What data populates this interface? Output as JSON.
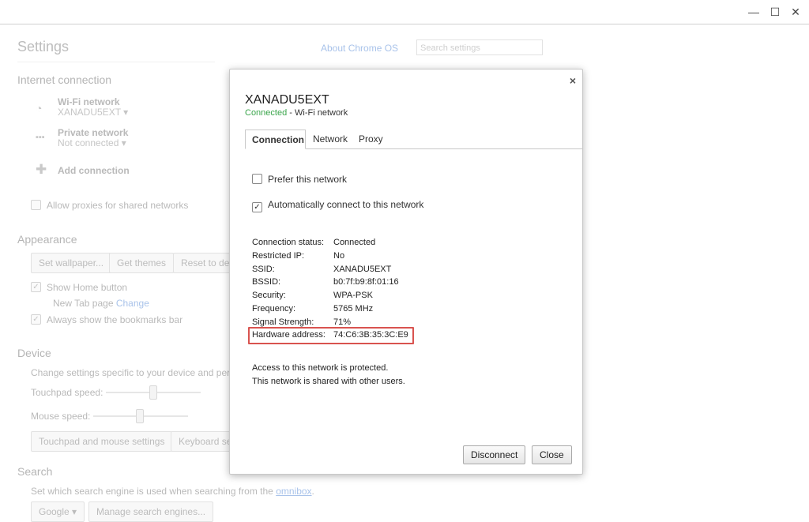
{
  "window": {
    "minimize": "—",
    "maximize": "☐",
    "close": "✕"
  },
  "settings": {
    "title": "Settings",
    "about_link": "About Chrome OS",
    "search_placeholder": "Search settings",
    "internet": {
      "heading": "Internet connection",
      "wifi_label": "Wi-Fi network",
      "wifi_value": "XANADU5EXT",
      "private_label": "Private network",
      "private_value": "Not connected",
      "add_connection": "Add connection",
      "allow_proxies": "Allow proxies for shared networks"
    },
    "appearance": {
      "heading": "Appearance",
      "set_wallpaper": "Set wallpaper...",
      "get_themes": "Get themes",
      "reset": "Reset to defa",
      "show_home": "Show Home button",
      "new_tab": "New Tab page",
      "change": "Change",
      "bookmarks_bar": "Always show the bookmarks bar"
    },
    "device": {
      "heading": "Device",
      "desc": "Change settings specific to your device and periph",
      "touchpad_speed": "Touchpad speed:",
      "mouse_speed": "Mouse speed:",
      "touchpad_mouse_btn": "Touchpad and mouse settings",
      "keyboard_btn": "Keyboard se"
    },
    "search": {
      "heading": "Search",
      "desc": "Set which search engine is used when searching from the",
      "omnibox": "omnibox",
      "engine": "Google",
      "manage": "Manage search engines..."
    }
  },
  "dialog": {
    "title": "XANADU5EXT",
    "status": "Connected",
    "status_suffix": " - Wi-Fi network",
    "tabs": [
      "Connection",
      "Network",
      "Proxy"
    ],
    "prefer_label": "Prefer this network",
    "prefer_checked": false,
    "auto_label": "Automatically connect to this network",
    "auto_checked": true,
    "details": [
      {
        "label": "Connection status:",
        "value": "Connected"
      },
      {
        "label": "Restricted IP:",
        "value": "No"
      },
      {
        "label": "SSID:",
        "value": "XANADU5EXT"
      },
      {
        "label": "BSSID:",
        "value": "b0:7f:b9:8f:01:16"
      },
      {
        "label": "Security:",
        "value": "WPA-PSK"
      },
      {
        "label": "Frequency:",
        "value": "5765 MHz"
      },
      {
        "label": "Signal Strength:",
        "value": "71%"
      },
      {
        "label": "Hardware address:",
        "value": "74:C6:3B:35:3C:E9"
      }
    ],
    "note1": "Access to this network is protected.",
    "note2": "This network is shared with other users.",
    "disconnect": "Disconnect",
    "close": "Close",
    "close_icon": "×",
    "highlight_color": "#d9534f",
    "connected_color": "#3aa54b"
  }
}
